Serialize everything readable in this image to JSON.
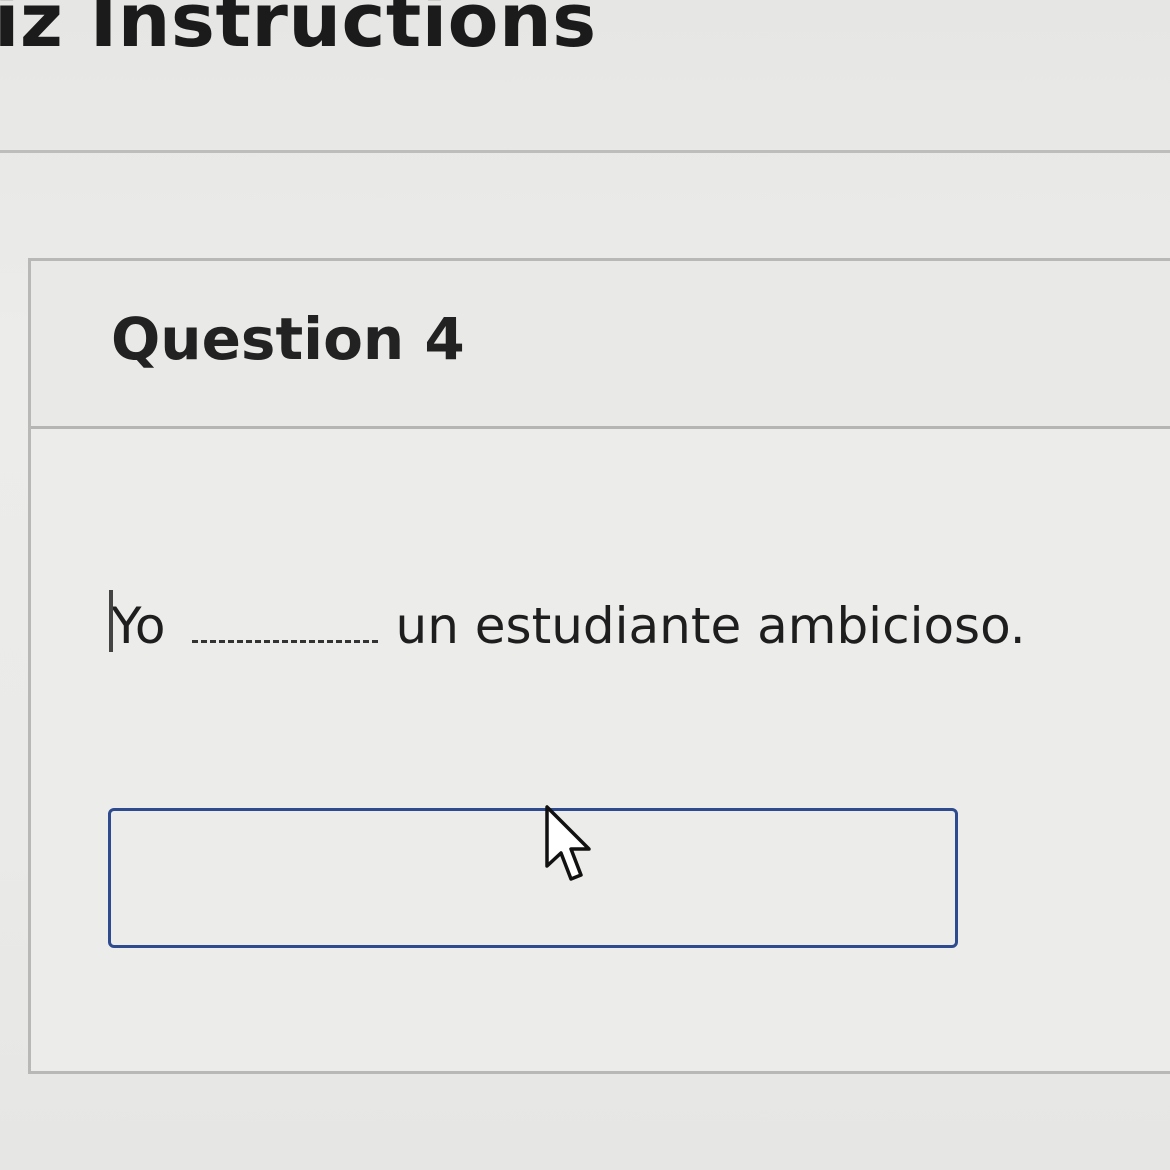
{
  "header": {
    "title": "iz Instructions"
  },
  "question": {
    "title": "Question 4",
    "prompt_before": "Yo",
    "prompt_after": "un estudiante ambicioso.",
    "answer": {
      "value": "",
      "placeholder": ""
    }
  },
  "colors": {
    "background": "#ececea",
    "text": "#1c1c1c",
    "input_border": "#2f4b8f",
    "divider": "#b8b8b6"
  },
  "icons": {
    "pointer": "mouse-pointer-icon"
  }
}
